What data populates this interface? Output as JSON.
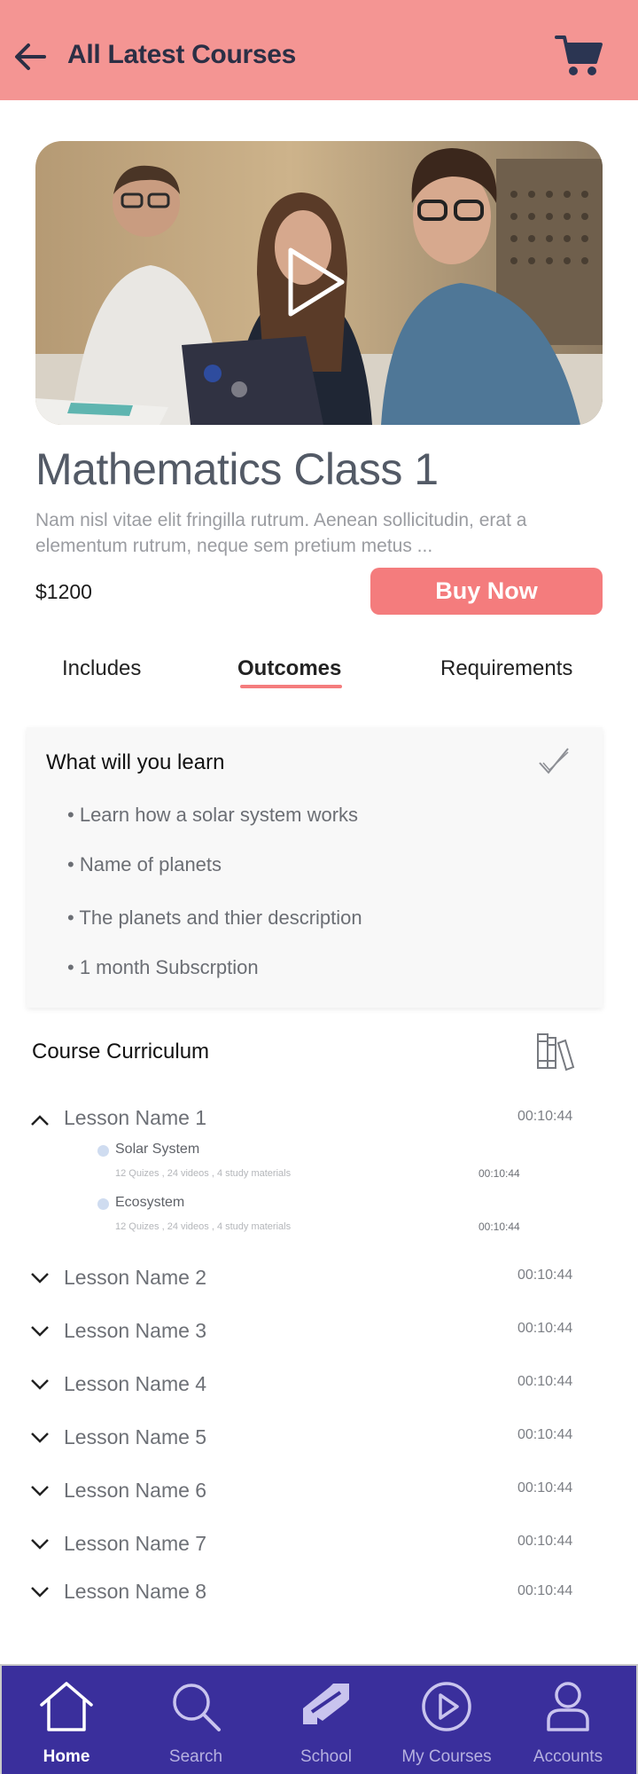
{
  "header": {
    "title": "All Latest Courses",
    "back_icon": "arrow-left-icon",
    "cart_icon": "shopping-cart-icon"
  },
  "course": {
    "title": "Mathematics Class 1",
    "description": "Nam  nisl vitae elit fringilla rutrum. Aenean sollicitudin, erat a elementum rutrum, neque sem pretium metus ...",
    "price": "$1200",
    "buy_label": "Buy Now"
  },
  "tabs": [
    {
      "label": "Includes",
      "active": false
    },
    {
      "label": "Outcomes",
      "active": true
    },
    {
      "label": "Requirements",
      "active": false
    }
  ],
  "learn": {
    "title": "What will you learn",
    "items": [
      "Learn how a solar system works",
      "Name of planets",
      "The planets and thier description",
      "1 month Subscrption"
    ]
  },
  "curriculum": {
    "title": "Course Curriculum",
    "lessons": [
      {
        "name": "Lesson Name 1",
        "time": "00:10:44",
        "expanded": true
      },
      {
        "name": "Lesson Name 2",
        "time": "00:10:44",
        "expanded": false
      },
      {
        "name": "Lesson Name 3",
        "time": "00:10:44",
        "expanded": false
      },
      {
        "name": "Lesson Name 4",
        "time": "00:10:44",
        "expanded": false
      },
      {
        "name": "Lesson Name 5",
        "time": "00:10:44",
        "expanded": false
      },
      {
        "name": "Lesson Name 6",
        "time": "00:10:44",
        "expanded": false
      },
      {
        "name": "Lesson Name 7",
        "time": "00:10:44",
        "expanded": false
      },
      {
        "name": "Lesson Name 8",
        "time": "00:10:44",
        "expanded": false
      }
    ],
    "sublessons": [
      {
        "name": "Solar System",
        "meta": "12 Quizes ,  24 videos , 4 study materials",
        "time": "00:10:44"
      },
      {
        "name": "Ecosystem",
        "meta": "12 Quizes ,  24 videos , 4 study materials",
        "time": "00:10:44"
      }
    ]
  },
  "nav": [
    {
      "label": "Home",
      "icon": "home-icon",
      "active": true
    },
    {
      "label": "Search",
      "icon": "search-icon",
      "active": false
    },
    {
      "label": "School",
      "icon": "school-arrows-icon",
      "active": false
    },
    {
      "label": "My Courses",
      "icon": "play-circle-icon",
      "active": false
    },
    {
      "label": "Accounts",
      "icon": "user-icon",
      "active": false
    }
  ],
  "colors": {
    "header_bg": "#f49593",
    "accent": "#f47c7d",
    "nav_bg": "#3a2f9c"
  }
}
